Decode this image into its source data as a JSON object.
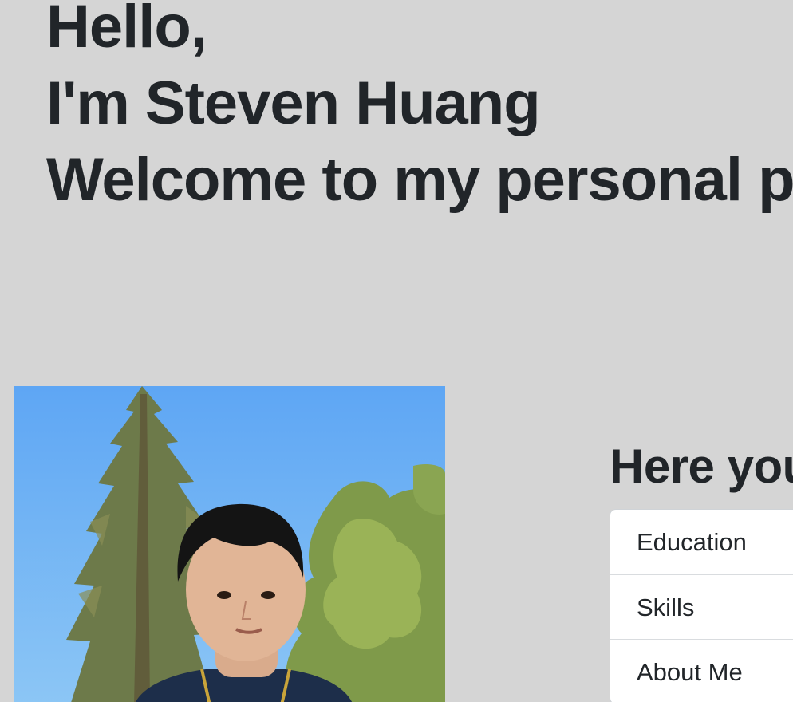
{
  "hero": {
    "line1": "Hello,",
    "line2": "I'm Steven Huang",
    "line3": "Welcome to my personal pa"
  },
  "profile_photo": {
    "alt": "Steven Huang"
  },
  "section": {
    "title": "Here you"
  },
  "nav_list": {
    "items": [
      {
        "label": "Education"
      },
      {
        "label": "Skills"
      },
      {
        "label": "About Me"
      }
    ]
  },
  "colors": {
    "background": "#d5d5d5",
    "text": "#212529",
    "list_background": "#ffffff",
    "sky_top": "#62a7f2",
    "sky_bottom": "#86c2f6"
  }
}
